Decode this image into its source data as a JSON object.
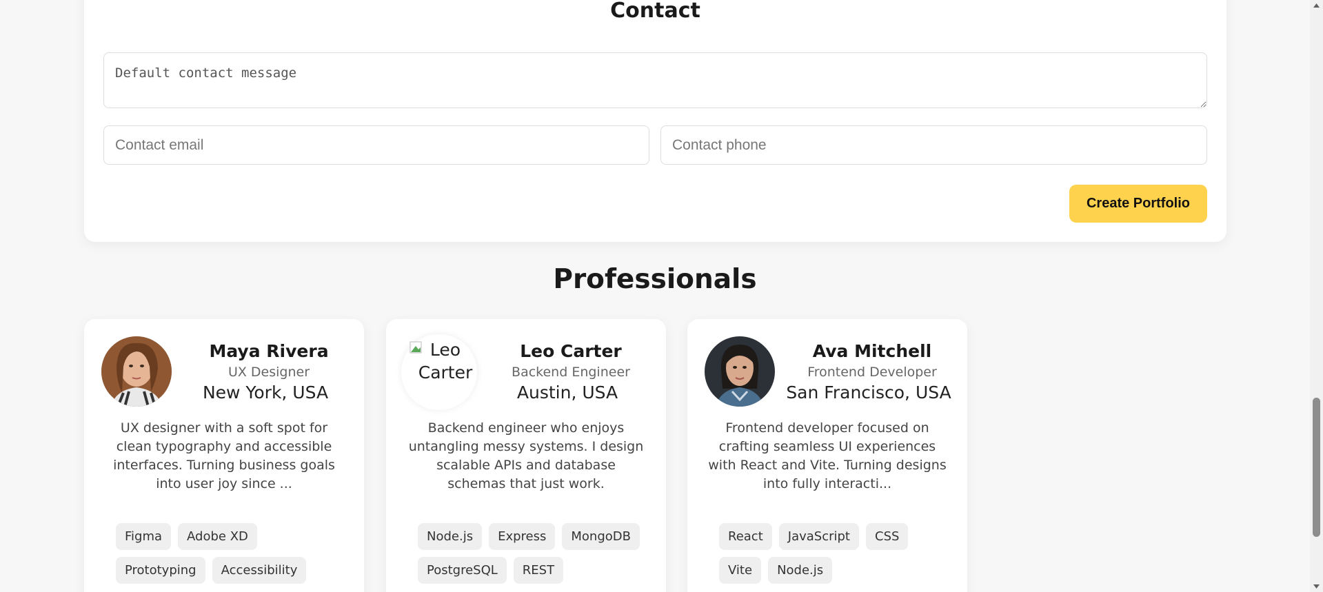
{
  "contact": {
    "title": "Contact",
    "message_placeholder": "Default contact message",
    "email_placeholder": "Contact email",
    "phone_placeholder": "Contact phone",
    "submit_label": "Create Portfolio"
  },
  "professionals": {
    "title": "Professionals",
    "cards": [
      {
        "name": "Maya Rivera",
        "role": "UX Designer",
        "location": "New York, USA",
        "bio": "UX designer with a soft spot for clean typography and accessible interfaces. Turning business goals into user joy since ...",
        "tags": [
          "Figma",
          "Adobe XD",
          "Prototyping",
          "Accessibility"
        ]
      },
      {
        "name": "Leo Carter",
        "role": "Backend Engineer",
        "location": "Austin, USA",
        "avatar_alt": "Leo Carter",
        "bio": "Backend engineer who enjoys untangling messy systems. I design scalable APIs and database schemas that just work.",
        "tags": [
          "Node.js",
          "Express",
          "MongoDB",
          "PostgreSQL",
          "REST"
        ]
      },
      {
        "name": "Ava Mitchell",
        "role": "Frontend Developer",
        "location": "San Francisco, USA",
        "bio": "Frontend developer focused on crafting seamless UI experiences with React and Vite. Turning designs into fully interacti...",
        "tags": [
          "React",
          "JavaScript",
          "CSS",
          "Vite",
          "Node.js"
        ]
      }
    ]
  },
  "colors": {
    "accent": "#ffd24d",
    "page_background": "#f7f7f7",
    "card_background": "#ffffff",
    "tag_background": "#efefef"
  },
  "icons": {
    "broken_image": "broken-image-icon",
    "scroll_up": "scroll-up-arrow-icon",
    "scroll_down": "scroll-down-arrow-icon"
  }
}
